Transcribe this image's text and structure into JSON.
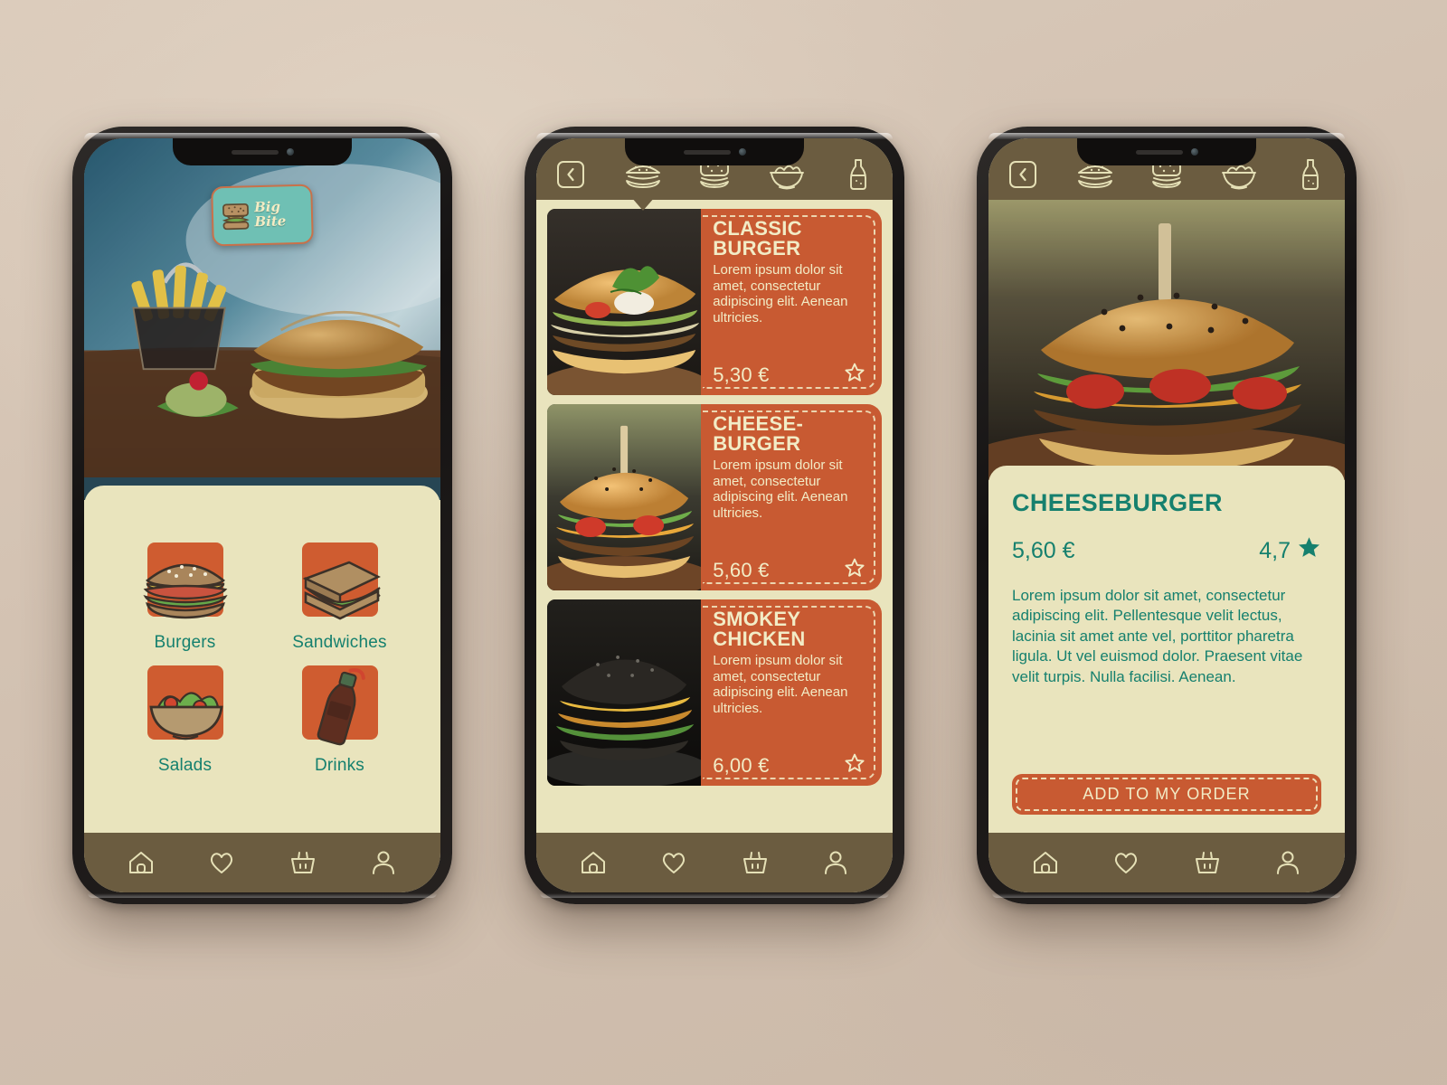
{
  "app": {
    "logo_name": "Big Bite",
    "brand_orange": "#c85a32",
    "brand_teal": "#16806e",
    "brand_brown": "#6b5c40",
    "brand_cream": "#e9e4bd"
  },
  "bottom_nav": [
    {
      "icon": "home-icon",
      "label": "Home"
    },
    {
      "icon": "heart-icon",
      "label": "Favorites"
    },
    {
      "icon": "basket-icon",
      "label": "Basket"
    },
    {
      "icon": "person-icon",
      "label": "Profile"
    }
  ],
  "screen_home": {
    "categories": [
      {
        "icon": "burger-illustration",
        "label": "Burgers"
      },
      {
        "icon": "sandwich-illustration",
        "label": "Sandwiches"
      },
      {
        "icon": "salad-bowl-illustration",
        "label": "Salads"
      },
      {
        "icon": "soda-bottle-illustration",
        "label": "Drinks"
      }
    ]
  },
  "screen_menu": {
    "top_nav": [
      {
        "icon": "back-chevron-icon",
        "label": "Back",
        "active": false
      },
      {
        "icon": "burger-icon",
        "label": "Burgers",
        "active": true
      },
      {
        "icon": "sandwich-icon",
        "label": "Sandwiches",
        "active": false
      },
      {
        "icon": "salad-bowl-icon",
        "label": "Salads",
        "active": false
      },
      {
        "icon": "bottle-icon",
        "label": "Drinks",
        "active": false
      }
    ],
    "items": [
      {
        "title": "CLASSIC BURGER",
        "description": "Lorem ipsum dolor sit amet, consectetur adipiscing elit. Aenean ultricies.",
        "price": "5,30 €",
        "favorite_icon": "star-outline-icon"
      },
      {
        "title": "CHEESE-BURGER",
        "description": "Lorem ipsum dolor sit amet, consectetur adipiscing elit. Aenean ultricies.",
        "price": "5,60 €",
        "favorite_icon": "star-outline-icon"
      },
      {
        "title": "SMOKEY CHICKEN",
        "description": "Lorem ipsum dolor sit amet, consectetur adipiscing elit. Aenean ultricies.",
        "price": "6,00 €",
        "favorite_icon": "star-outline-icon"
      }
    ]
  },
  "screen_detail": {
    "top_nav": [
      {
        "icon": "back-chevron-icon",
        "label": "Back",
        "active": false
      },
      {
        "icon": "burger-icon",
        "label": "Burgers",
        "active": false
      },
      {
        "icon": "sandwich-icon",
        "label": "Sandwiches",
        "active": false
      },
      {
        "icon": "salad-bowl-icon",
        "label": "Salads",
        "active": false
      },
      {
        "icon": "bottle-icon",
        "label": "Drinks",
        "active": false
      }
    ],
    "title": "CHEESEBURGER",
    "price": "5,60 €",
    "rating": "4,7",
    "rating_icon": "star-filled-icon",
    "description": "Lorem ipsum dolor sit amet, consectetur adipiscing elit. Pellentesque velit lectus, lacinia sit amet ante vel, porttitor pharetra ligula. Ut vel euismod dolor. Praesent vitae velit turpis. Nulla facilisi. Aenean.",
    "add_button_label": "ADD TO MY ORDER"
  }
}
